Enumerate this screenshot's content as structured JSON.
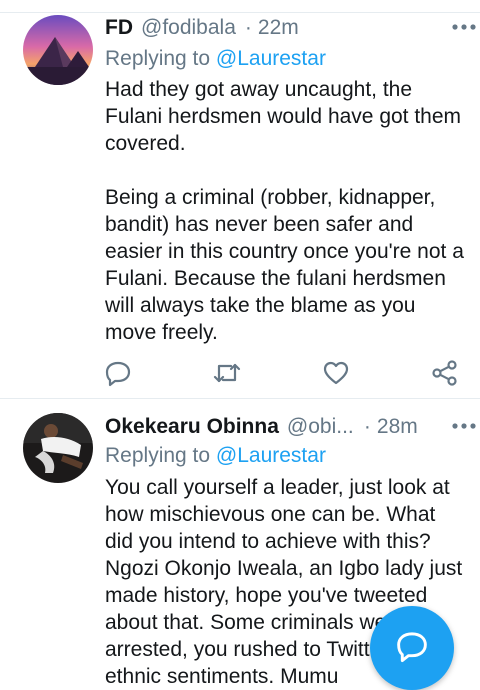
{
  "tweets": [
    {
      "display_name": "FD",
      "handle": "@fodibala",
      "separator": "·",
      "time": "22m",
      "replying_prefix": "Replying to",
      "replying_to": "@Laurestar",
      "paragraphs": [
        "Had they got away uncaught, the\nFulani herdsmen would have got them\ncovered.",
        "Being a criminal (robber, kidnapper,\nbandit) has never been safer and\neasier in this country once you're not a\nFulani. Because the fulani herdsmen\nwill always take the blame as you\nmove freely."
      ],
      "actions": [
        "reply-icon",
        "retweet-icon",
        "like-icon",
        "share-icon"
      ]
    },
    {
      "display_name": "Okekearu Obinna",
      "handle": "@obi...",
      "separator": "·",
      "time": "28m",
      "replying_prefix": "Replying to",
      "replying_to": "@Laurestar",
      "paragraphs": [
        "You call yourself a leader, just look at\nhow mischievous one can be. What\ndid you intend to achieve with this?\nNgozi Okonjo Iweala, an Igbo lady just\nmade history, hope you've tweeted\nabout that. Some criminals were\narrested, you rushed to Twitter\nethnic sentiments. Mumu"
      ]
    }
  ],
  "compose_icon": "compose-reply-icon",
  "colors": {
    "accent": "#1da1f2",
    "secondary_text": "#657786",
    "primary_text": "#14171a",
    "divider": "#e6ecf0"
  }
}
